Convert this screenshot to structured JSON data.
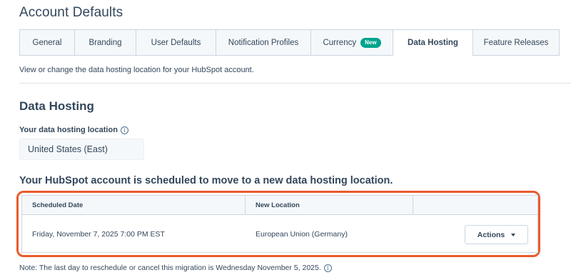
{
  "page": {
    "title": "Account Defaults",
    "description": "View or change the data hosting location for your HubSpot account."
  },
  "tabs": [
    {
      "label": "General",
      "active": false
    },
    {
      "label": "Branding",
      "active": false
    },
    {
      "label": "User Defaults",
      "active": false
    },
    {
      "label": "Notification Profiles",
      "active": false
    },
    {
      "label": "Currency",
      "active": false,
      "badge": "New"
    },
    {
      "label": "Data Hosting",
      "active": true
    },
    {
      "label": "Feature Releases",
      "active": false
    }
  ],
  "section": {
    "title": "Data Hosting",
    "location_label": "Your data hosting location",
    "location_value": "United States (East)",
    "info_icon": "info-circle-icon"
  },
  "migration": {
    "heading": "Your HubSpot account is scheduled to move to a new data hosting location.",
    "columns": [
      "Scheduled Date",
      "New Location",
      ""
    ],
    "rows": [
      {
        "scheduled_date": "Friday, November 7, 2025 7:00 PM EST",
        "new_location": "European Union (Germany)",
        "action_label": "Actions"
      }
    ],
    "note": "Note: The last day to reschedule or cancel this migration is Wednesday November 5, 2025."
  },
  "colors": {
    "text": "#33475b",
    "highlight": "#ea5b2c",
    "badge": "#00a38d",
    "tab_bg": "#f5f8fa",
    "border": "#cbd6e2"
  }
}
